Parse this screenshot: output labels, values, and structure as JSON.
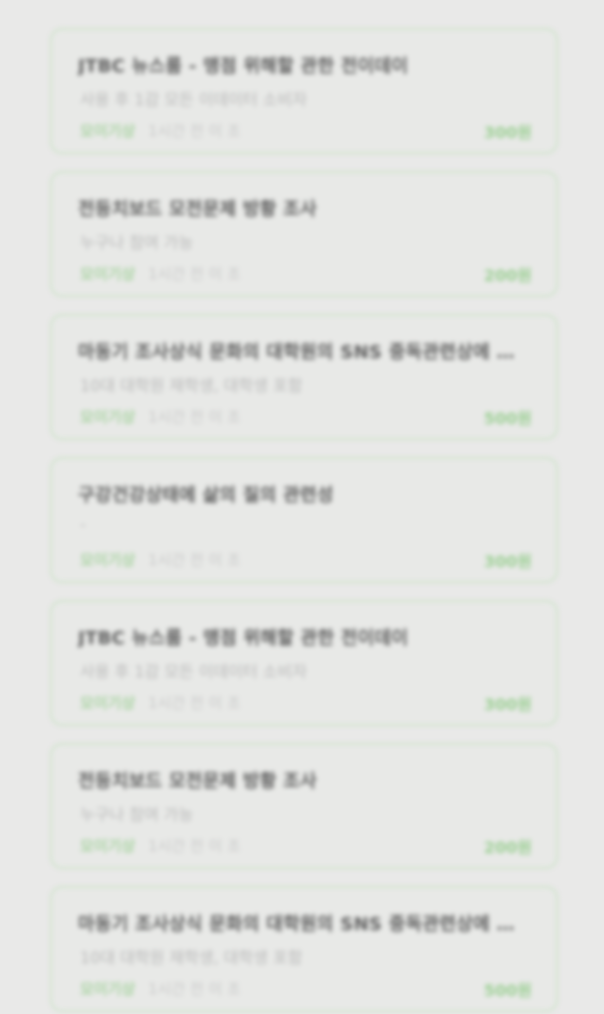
{
  "cards": [
    {
      "title": "JTBC 뉴스룸 - 맹점 위해할 관한 전이데이",
      "subtitle": "사용 후 1감 모든 이데이터 소비자",
      "status": "모이기상",
      "time": "1시간 전 이 조",
      "points": "300원"
    },
    {
      "title": "전등치보드 모전문제 방황 조사",
      "subtitle": "누구나 참여 가능",
      "status": "모이기상",
      "time": "1시간 전 이 조",
      "points": "200원"
    },
    {
      "title": "마동기 조사상식 문화의 대학원의 SNS 중독관련상에 관한 설문조사",
      "subtitle": "10대 대학원 재학생, 대학생 포함",
      "status": "모이기상",
      "time": "1시간 전 이 조",
      "points": "500원"
    },
    {
      "title": "구강건강상태에 삶의 질의 관련성",
      "subtitle": "-",
      "status": "모이기상",
      "time": "1시간 전 이 조",
      "points": "300원"
    },
    {
      "title": "JTBC 뉴스룸 - 맹점 위해할 관한 전이데이",
      "subtitle": "사용 후 1감 모든 이데이터 소비자",
      "status": "모이기상",
      "time": "1시간 전 이 조",
      "points": "300원"
    },
    {
      "title": "전등치보드 모전문제 방황 조사",
      "subtitle": "누구나 참여 가능",
      "status": "모이기상",
      "time": "1시간 전 이 조",
      "points": "200원"
    },
    {
      "title": "마동기 조사상식 문화의 대학원의 SNS 중독관련상에 관한 설문조사",
      "subtitle": "10대 대학원 재학생, 대학생 포함",
      "status": "모이기상",
      "time": "1시간 전 이 조",
      "points": "500원"
    }
  ]
}
